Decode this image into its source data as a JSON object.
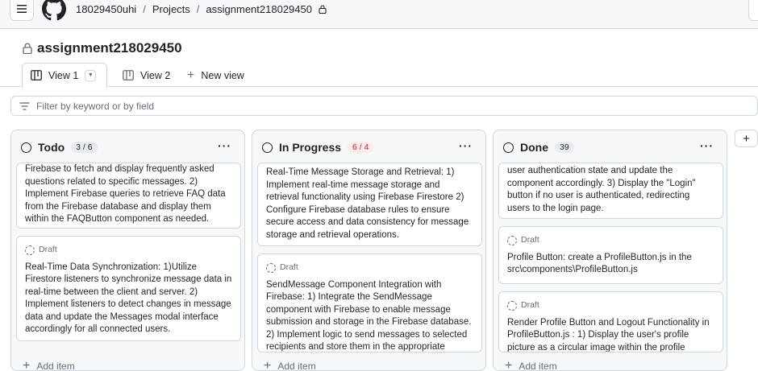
{
  "breadcrumb": {
    "user": "18029450uhi",
    "projects": "Projects",
    "repo": "assignment218029450"
  },
  "page_title": "assignment218029450",
  "tabs": [
    {
      "label": "View 1"
    },
    {
      "label": "View 2"
    },
    {
      "label": "New view"
    }
  ],
  "filter": {
    "placeholder": "Filter by keyword or by field"
  },
  "columns": [
    {
      "title": "Todo",
      "count": "3 / 6",
      "cards": [
        {
          "draft": "",
          "text": "Firebase to fetch and display frequently asked questions related to specific messages. 2) Implement Firebase queries to retrieve FAQ data from the Firebase database and display them within the FAQButton component as needed."
        },
        {
          "draft": "Draft",
          "text": "Real-Time Data Synchronization: 1)Utilize Firestore listeners to synchronize message data in real-time between the client and server. 2) Implement listeners to detect changes in message data and update the Messages modal interface accordingly for all connected users."
        }
      ],
      "add_item": "Add item"
    },
    {
      "title": "In Progress",
      "count": "6 / 4",
      "cards": [
        {
          "draft": "",
          "text": "Real-Time Message Storage and Retrieval: 1) Implement real-time message storage and retrieval functionality using Firebase Firestore 2) Configure Firebase database rules to ensure secure access and data consistency for message storage and retrieval operations."
        },
        {
          "draft": "Draft",
          "text": "SendMessage Component Integration with Firebase: 1) Integrate the SendMessage component with Firebase to enable message submission and storage in the Firebase database. 2) Implement logic to send messages to selected recipients and store them in the appropriate"
        }
      ],
      "add_item": "Add item"
    },
    {
      "title": "Done",
      "count": "39",
      "cards": [
        {
          "draft": "",
          "text": "user authentication state and update the component accordingly. 3) Display the \"Login\" button if no user is authenticated, redirecting users to the login page."
        },
        {
          "draft": "Draft",
          "text": "Profile Button: create a ProfileButton.js in the src\\components\\ProfileButton.js"
        },
        {
          "draft": "Draft",
          "text": "Render Profile Button and Logout Functionality in ProfileButton.js : 1) Display the user's profile picture as a circular image within the profile"
        }
      ],
      "add_item": "Add item"
    }
  ]
}
